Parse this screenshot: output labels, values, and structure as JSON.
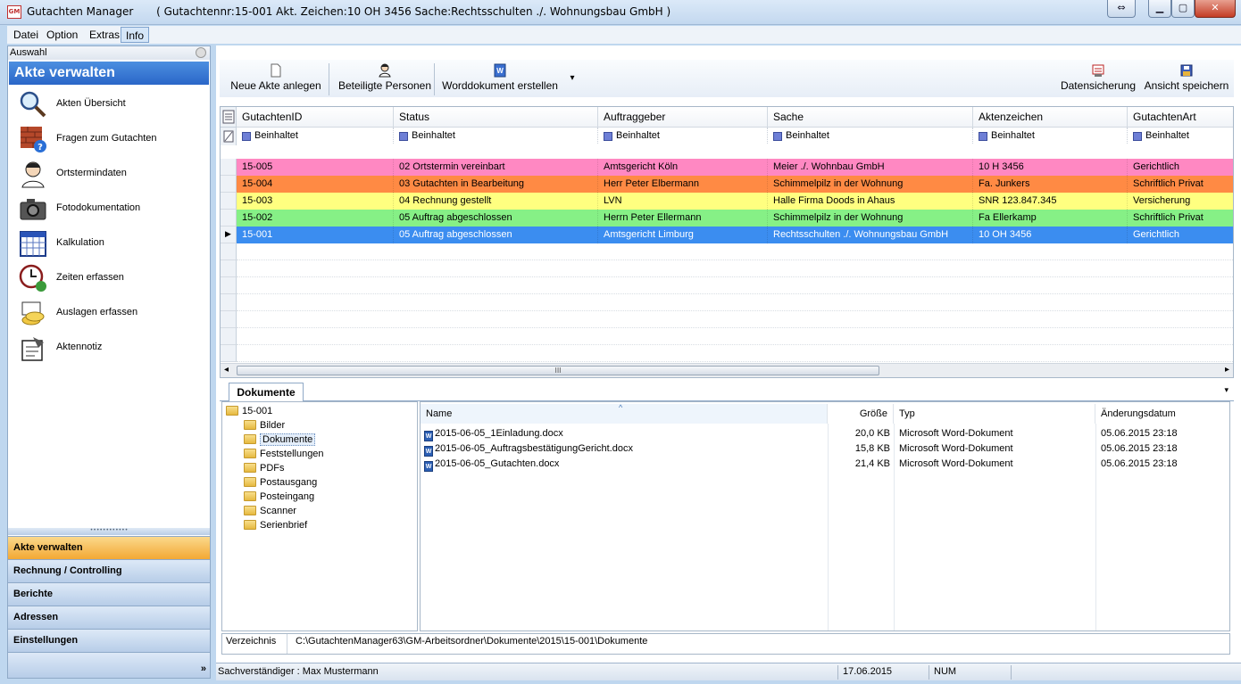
{
  "window": {
    "app_title": "Gutachten Manager",
    "context": "( Gutachtennr:15-001   Akt. Zeichen:10 OH 3456   Sache:Rechtsschulten ./. Wohnungsbau GmbH )",
    "icon_text": "GM",
    "restore_glyph": "⇔",
    "min_glyph": "▁",
    "max_glyph": "▢",
    "close_glyph": "✕"
  },
  "menu": [
    "Datei",
    "Option",
    "Extras",
    "Info"
  ],
  "sidebar": {
    "auswahl": "Auswahl",
    "header": "Akte verwalten",
    "items": [
      {
        "label": "Akten Übersicht",
        "icon": "magnifier-icon"
      },
      {
        "label": "Fragen zum Gutachten",
        "icon": "question-wall-icon"
      },
      {
        "label": "Ortstermindaten",
        "icon": "person-icon"
      },
      {
        "label": "Fotodokumentation",
        "icon": "camera-icon"
      },
      {
        "label": "Kalkulation",
        "icon": "calendar-icon"
      },
      {
        "label": "Zeiten erfassen",
        "icon": "clock-icon"
      },
      {
        "label": "Auslagen erfassen",
        "icon": "coins-icon"
      },
      {
        "label": "Aktennotiz",
        "icon": "note-icon"
      }
    ],
    "sections": [
      "Akte verwalten",
      "Rechnung / Controlling",
      "Berichte",
      "Adressen",
      "Einstellungen"
    ],
    "splitter_dots": "••••••••••••",
    "more": "»"
  },
  "toolbar": {
    "new_case": "Neue Akte anlegen",
    "persons": "Beteiligte Personen",
    "word": "Worddokument erstellen",
    "word_dropdown": "▾",
    "backup": "Datensicherung",
    "save_view": "Ansicht speichern"
  },
  "grid": {
    "columns": [
      "GutachtenID",
      "Status",
      "Auftraggeber",
      "Sache",
      "Aktenzeichen",
      "GutachtenArt"
    ],
    "filter": "Beinhaltet",
    "current_marker": "▶",
    "rows": [
      {
        "id": "15-005",
        "status": "02 Ortstermin vereinbart",
        "auftraggeber": "Amtsgericht Köln",
        "sache": "Meier ./. Wohnbau GmbH",
        "aktenzeichen": "10 H 3456",
        "art": "Gerichtlich",
        "color": "#ff88c2"
      },
      {
        "id": "15-004",
        "status": "03 Gutachten in Bearbeitung",
        "auftraggeber": "Herr Peter Elbermann",
        "sache": "Schimmelpilz in der Wohnung",
        "aktenzeichen": "Fa. Junkers",
        "art": "Schriftlich Privat",
        "color": "#ff8a44"
      },
      {
        "id": "15-003",
        "status": "04 Rechnung gestellt",
        "auftraggeber": "LVN",
        "sache": "Halle Firma Doods in Ahaus",
        "aktenzeichen": "SNR 123.847.345",
        "art": "Versicherung",
        "color": "#ffff80"
      },
      {
        "id": "15-002",
        "status": "05 Auftrag abgeschlossen",
        "auftraggeber": "Herrn Peter Ellermann",
        "sache": "Schimmelpilz in der Wohnung",
        "aktenzeichen": "Fa Ellerkamp",
        "art": "Schriftlich Privat",
        "color": "#86f086"
      },
      {
        "id": "15-001",
        "status": "05 Auftrag abgeschlossen",
        "auftraggeber": "Amtsgericht Limburg",
        "sache": "Rechtsschulten ./. Wohnungsbau GmbH",
        "aktenzeichen": "10 OH 3456",
        "art": "Gerichtlich",
        "color": "#3b8df0"
      }
    ],
    "scroll_left": "◂",
    "scroll_right": "▸",
    "scroll_grip": "III"
  },
  "documents": {
    "tab": "Dokumente",
    "tab_dropdown": "▾",
    "tree": {
      "root": "15-001",
      "children": [
        "Bilder",
        "Dokumente",
        "Feststellungen",
        "PDFs",
        "Postausgang",
        "Posteingang",
        "Scanner",
        "Serienbrief"
      ]
    },
    "sort_indicator": "^",
    "columns": [
      "Name",
      "Größe",
      "Typ",
      "Änderungsdatum"
    ],
    "files": [
      {
        "name": "2015-06-05_1Einladung.docx",
        "size": "20,0 KB",
        "type": "Microsoft Word-Dokument",
        "date": "05.06.2015 23:18"
      },
      {
        "name": "2015-06-05_AuftragsbestätigungGericht.docx",
        "size": "15,8 KB",
        "type": "Microsoft Word-Dokument",
        "date": "05.06.2015 23:18"
      },
      {
        "name": "2015-06-05_Gutachten.docx",
        "size": "21,4 KB",
        "type": "Microsoft Word-Dokument",
        "date": "05.06.2015 23:18"
      }
    ],
    "path_label": "Verzeichnis",
    "path": "C:\\GutachtenManager63\\GM-Arbeitsordner\\Dokumente\\2015\\15-001\\Dokumente"
  },
  "status": {
    "user": "Sachverständiger : Max Mustermann",
    "date": "17.06.2015",
    "num": "NUM"
  }
}
